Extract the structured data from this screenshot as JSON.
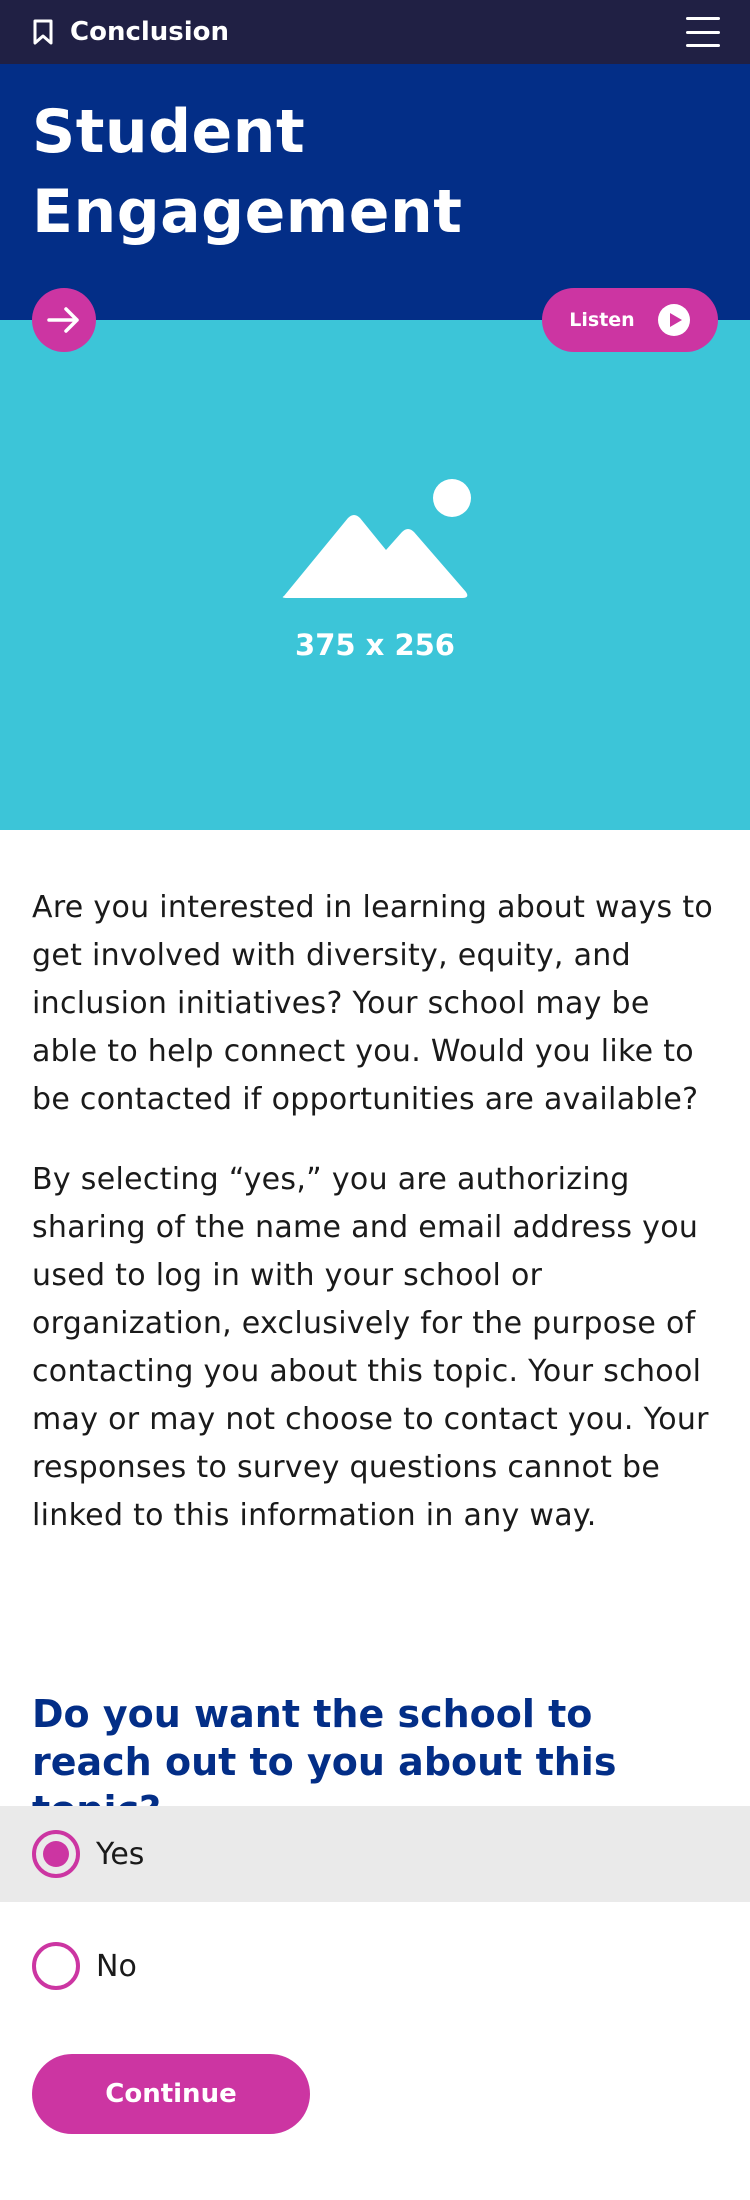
{
  "header": {
    "title": "Conclusion",
    "bookmark_icon": "bookmark-icon",
    "menu_icon": "hamburger-menu-icon"
  },
  "hero": {
    "title": "Student Engagement",
    "next_icon": "arrow-right-icon",
    "listen_label": "Listen",
    "listen_icon": "play-icon"
  },
  "image_placeholder": {
    "caption": "375 x 256",
    "icon": "image-placeholder-icon"
  },
  "body": {
    "paragraphs": [
      "Are you interested in learning about ways to get involved with diversity, equity, and inclusion initiatives? Your school may be able to help connect you. Would you like to be contacted if opportunities are available?",
      "By selecting “yes,” you are authorizing sharing of the name and email address you used to log in with your school or organization, exclusively for the purpose of contacting you about this topic. Your school may or may not choose to contact you. Your responses to survey questions cannot be linked to this information in any way."
    ]
  },
  "question": {
    "text": "Do you want the school to reach out to you about this topic?",
    "options": [
      {
        "label": "Yes",
        "selected": true
      },
      {
        "label": "No",
        "selected": false
      }
    ]
  },
  "continue_label": "Continue",
  "colors": {
    "topbar": "#202044",
    "hero": "#032e87",
    "image_bg": "#3cc5d8",
    "accent": "#cc35a2",
    "question_text": "#032e87",
    "selected_row": "#eaeaea"
  }
}
